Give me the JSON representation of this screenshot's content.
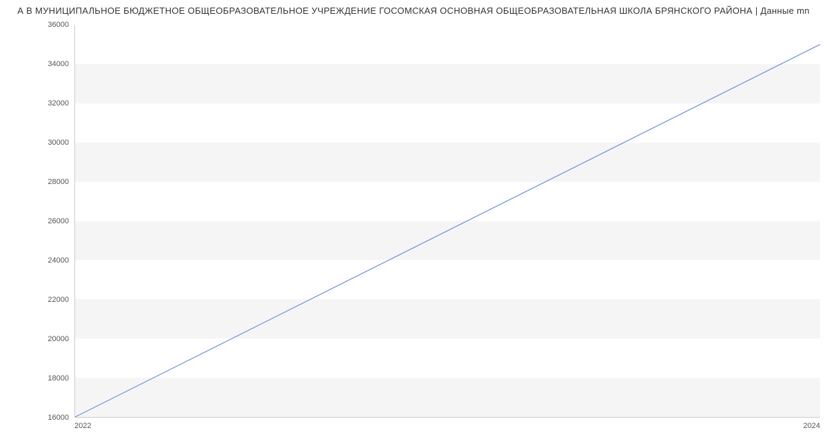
{
  "title": "А В МУНИЦИПАЛЬНОЕ БЮДЖЕТНОЕ ОБЩЕОБРАЗОВАТЕЛЬНОЕ УЧРЕЖДЕНИЕ ГОСОМСКАЯ ОСНОВНАЯ ОБЩЕОБРАЗОВАТЕЛЬНАЯ ШКОЛА БРЯНСКОГО РАЙОНА | Данные mn",
  "chart_data": {
    "type": "line",
    "x": [
      2022,
      2024
    ],
    "values": [
      16000,
      35000
    ],
    "yticks": [
      16000,
      18000,
      20000,
      22000,
      24000,
      26000,
      28000,
      30000,
      32000,
      34000,
      36000
    ],
    "xticks": [
      2022,
      2024
    ],
    "ylim": [
      16000,
      36000
    ],
    "xlim": [
      2022,
      2024
    ],
    "xlabel": "",
    "ylabel": "",
    "line_color": "#6a8fd8"
  }
}
